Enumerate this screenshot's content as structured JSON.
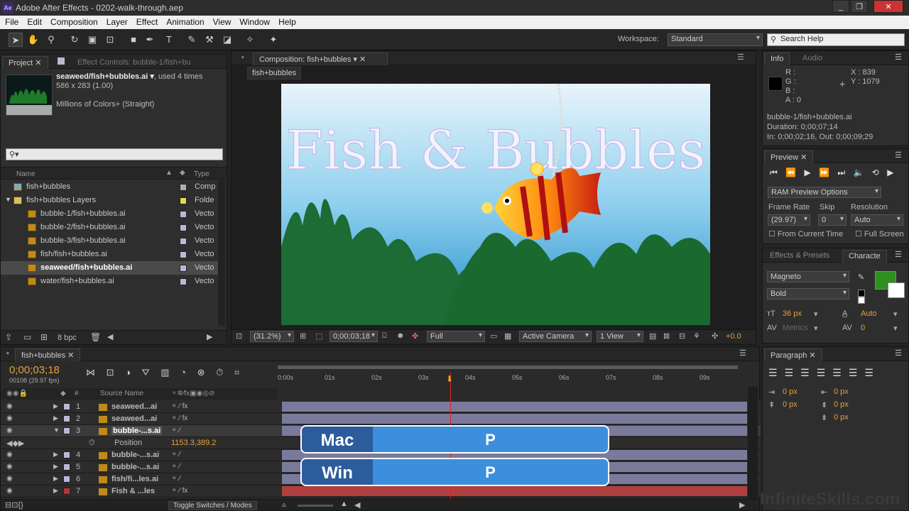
{
  "app": {
    "title": "Adobe After Effects - 0202-walk-through.aep",
    "icon": "Ae"
  },
  "menu": [
    "File",
    "Edit",
    "Composition",
    "Layer",
    "Effect",
    "Animation",
    "View",
    "Window",
    "Help"
  ],
  "toolbar": {
    "workspace_label": "Workspace:",
    "workspace_value": "Standard",
    "search_placeholder": "Search Help"
  },
  "project": {
    "tab_project": "Project",
    "tab_effects": "Effect Controls: bubble-1/fish+bu",
    "selected_name": "seaweed/fish+bubbles.ai ▾",
    "used": ", used 4 times",
    "dims": "586 x 283 (1.00)",
    "colors": "Millions of Colors+ (Straight)",
    "col_name": "Name",
    "col_type": "Type",
    "items": [
      {
        "name": "fish+bubbles",
        "type": "Comp",
        "indent": 0,
        "label": "#b0b0b0"
      },
      {
        "name": "fish+bubbles Layers",
        "type": "Folde",
        "indent": 0,
        "label": "#e8d84a"
      },
      {
        "name": "bubble-1/fish+bubbles.ai",
        "type": "Vecto",
        "indent": 1,
        "label": "#b8b8d8"
      },
      {
        "name": "bubble-2/fish+bubbles.ai",
        "type": "Vecto",
        "indent": 1,
        "label": "#b8b8d8"
      },
      {
        "name": "bubble-3/fish+bubbles.ai",
        "type": "Vecto",
        "indent": 1,
        "label": "#b8b8d8"
      },
      {
        "name": "fish/fish+bubbles.ai",
        "type": "Vecto",
        "indent": 1,
        "label": "#b8b8d8"
      },
      {
        "name": "seaweed/fish+bubbles.ai",
        "type": "Vecto",
        "indent": 1,
        "label": "#b8b8d8",
        "selected": true
      },
      {
        "name": "water/fish+bubbles.ai",
        "type": "Vecto",
        "indent": 1,
        "label": "#b8b8d8"
      }
    ],
    "bpc": "8 bpc"
  },
  "comp": {
    "tab": "Composition: fish+bubbles",
    "crumb": "fish+bubbles",
    "title_text": "Fish & Bubbles",
    "zoom": "(31.2%)",
    "timecode": "0;00;03;18",
    "quality": "Full",
    "camera": "Active Camera",
    "views": "1 View",
    "offset": "+0.0"
  },
  "info": {
    "tab_info": "Info",
    "tab_audio": "Audio",
    "r": "R :",
    "g": "G :",
    "b": "B :",
    "a": "A : 0",
    "x": "X : 839",
    "y": "Y : 1079",
    "layer": "bubble-1/fish+bubbles.ai",
    "duration": "Duration: 0;00;07;14",
    "inout": "In: 0;00;02;16, Out: 0;00;09;29"
  },
  "preview": {
    "tab": "Preview",
    "ram": "RAM Preview Options",
    "frame_rate_label": "Frame Rate",
    "skip_label": "Skip",
    "resolution_label": "Resolution",
    "frame_rate": "(29.97)",
    "skip": "0",
    "resolution": "Auto",
    "from_current": "From Current Time",
    "full_screen": "Full Screen"
  },
  "character": {
    "tab_effects": "Effects & Presets",
    "tab_char": "Characte",
    "font": "Magneto",
    "style": "Bold",
    "size": "36 px",
    "leading": "Auto",
    "kerning": "Metrics",
    "tracking": "0",
    "fill": "#2f8f1f"
  },
  "paragraph": {
    "tab": "Paragraph",
    "v1": "0 px",
    "v2": "0 px",
    "v3": "0 px",
    "v4": "0 px",
    "v5": "0 px"
  },
  "timeline": {
    "tab": "fish+bubbles",
    "timecode": "0;00;03;18",
    "frames": "00108 (29.97 fps)",
    "col_source": "Source Name",
    "ruler": [
      "0:00s",
      "01s",
      "02s",
      "03s",
      "04s",
      "05s",
      "06s",
      "07s",
      "08s",
      "09s"
    ],
    "layers": [
      {
        "num": "1",
        "name": "seaweed...ai",
        "label": "#b8b8d8",
        "fx": true
      },
      {
        "num": "2",
        "name": "seaweed...ai",
        "label": "#b8b8d8",
        "fx": true
      },
      {
        "num": "3",
        "name": "bubble-...s.ai",
        "label": "#b8b8d8",
        "fx": false,
        "open": true
      },
      {
        "num": "4",
        "name": "bubble-...s.ai",
        "label": "#b8b8d8",
        "fx": false
      },
      {
        "num": "5",
        "name": "bubble-...s.ai",
        "label": "#b8b8d8",
        "fx": false
      },
      {
        "num": "6",
        "name": "fish/fi...les.ai",
        "label": "#b8b8d8",
        "fx": false
      },
      {
        "num": "7",
        "name": "Fish & ...les",
        "label": "#c03030",
        "fx": true
      }
    ],
    "position_label": "Position",
    "position_value": "1153.3,389.2",
    "toggle": "Toggle Switches / Modes"
  },
  "overlay": {
    "mac_key": "Mac",
    "win_key": "Win",
    "shortcut": "P"
  },
  "watermark": "InfiniteSkills.com"
}
